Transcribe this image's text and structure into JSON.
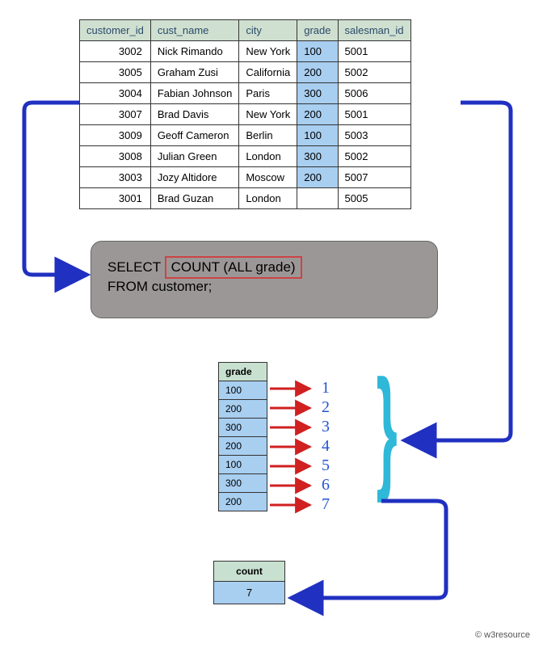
{
  "headers": [
    "customer_id",
    "cust_name",
    "city",
    "grade",
    "salesman_id"
  ],
  "rows": [
    {
      "id": "3002",
      "name": "Nick Rimando",
      "city": "New York",
      "grade": "100",
      "sid": "5001",
      "hl": true
    },
    {
      "id": "3005",
      "name": "Graham Zusi",
      "city": "California",
      "grade": "200",
      "sid": "5002",
      "hl": true
    },
    {
      "id": "3004",
      "name": "Fabian Johnson",
      "city": "Paris",
      "grade": "300",
      "sid": "5006",
      "hl": true
    },
    {
      "id": "3007",
      "name": "Brad Davis",
      "city": "New York",
      "grade": "200",
      "sid": "5001",
      "hl": true
    },
    {
      "id": "3009",
      "name": "Geoff Cameron",
      "city": "Berlin",
      "grade": "100",
      "sid": "5003",
      "hl": true
    },
    {
      "id": "3008",
      "name": "Julian Green",
      "city": "London",
      "grade": "300",
      "sid": "5002",
      "hl": true
    },
    {
      "id": "3003",
      "name": "Jozy Altidore",
      "city": "Moscow",
      "grade": "200",
      "sid": "5007",
      "hl": true
    },
    {
      "id": "3001",
      "name": "Brad Guzan",
      "city": "London",
      "grade": "",
      "sid": "5005",
      "hl": false
    }
  ],
  "sql": {
    "pre": "SELECT ",
    "hl": "COUNT (ALL grade)",
    "post": "FROM customer;"
  },
  "grade_header": "grade",
  "grades": [
    "100",
    "200",
    "300",
    "200",
    "100",
    "300",
    "200"
  ],
  "nums": [
    "1",
    "2",
    "3",
    "4",
    "5",
    "6",
    "7"
  ],
  "count": {
    "header": "count",
    "value": "7"
  },
  "footer": "© w3resource"
}
